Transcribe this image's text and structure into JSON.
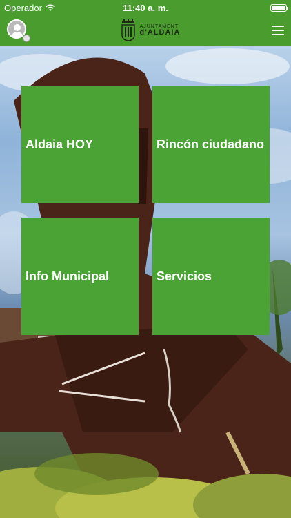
{
  "status": {
    "carrier": "Operador",
    "time": "11:40 a. m.",
    "battery_level": 1.0
  },
  "header": {
    "logo_line1": "AJUNTAMENT",
    "logo_line2": "d'ALDAIA",
    "brand_color": "#4a9c2f"
  },
  "tiles": [
    {
      "label": "Aldaia HOY"
    },
    {
      "label": "Rincón ciudadano"
    },
    {
      "label": "Info Municipal"
    },
    {
      "label": "Servicios"
    }
  ],
  "colors": {
    "tile": "#4ba235",
    "text": "#ffffff"
  }
}
